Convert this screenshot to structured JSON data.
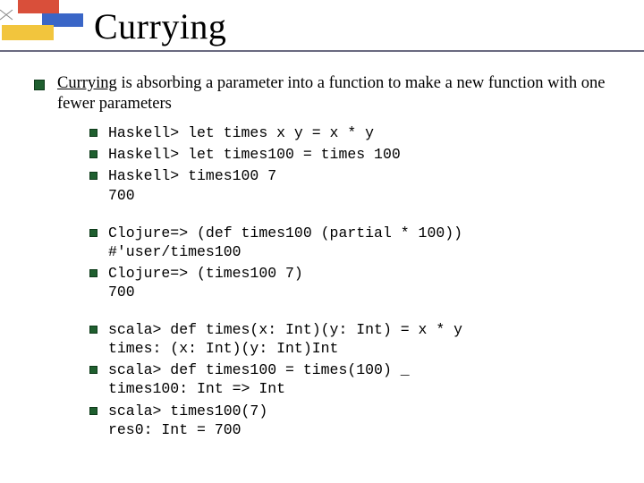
{
  "title": "Currying",
  "intro": {
    "term": "Currying",
    "rest": " is absorbing a parameter into a function to make a new function with one fewer parameters"
  },
  "groups": [
    [
      "Haskell> let times x y = x * y",
      "Haskell> let times100 = times 100",
      "Haskell> times100 7\n700"
    ],
    [
      "Clojure=> (def times100 (partial * 100))\n#'user/times100",
      "Clojure=> (times100 7)\n700"
    ],
    [
      "scala> def times(x: Int)(y: Int) = x * y\ntimes: (x: Int)(y: Int)Int",
      "scala> def times100 = times(100) _\ntimes100: Int => Int",
      "scala> times100(7)\nres0: Int = 700"
    ]
  ]
}
